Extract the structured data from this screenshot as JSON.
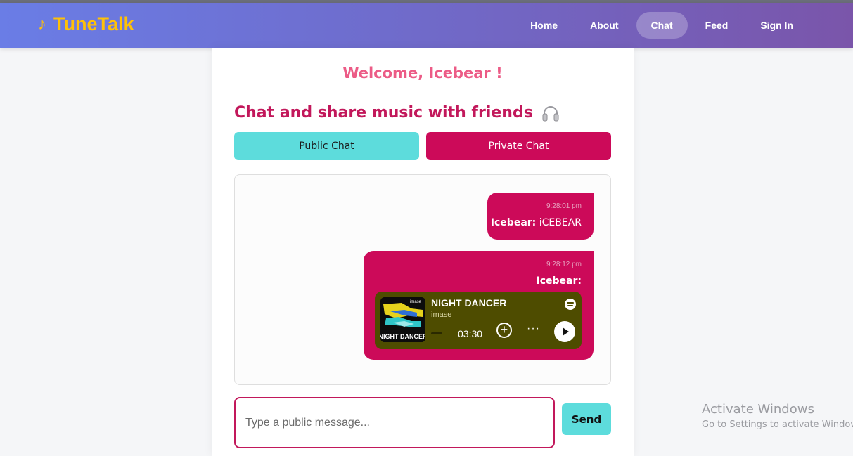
{
  "app": {
    "brand": "TuneTalk",
    "brand_icon": "music-note-icon",
    "colors": {
      "brand": "#ffc107",
      "accent": "#cc0a59",
      "secondary": "#5ddcdc"
    }
  },
  "nav": {
    "items": [
      {
        "label": "Home",
        "active": false
      },
      {
        "label": "About",
        "active": false
      },
      {
        "label": "Chat",
        "active": true
      },
      {
        "label": "Feed",
        "active": false
      },
      {
        "label": "Sign In",
        "active": false
      }
    ]
  },
  "main": {
    "welcome": "Welcome, Icebear !",
    "subtitle": "Chat and share music with friends",
    "subtitle_icon": "headphones-icon",
    "tabs": {
      "public": "Public Chat",
      "private": "Private Chat"
    }
  },
  "messages": [
    {
      "time": "9:28:01 pm",
      "sender": "Icebear:",
      "text": "iCEBEAR"
    },
    {
      "time": "9:28:12 pm",
      "sender": "Icebear:",
      "text": "",
      "embed": {
        "title": "NIGHT DANCER",
        "artist": "imase",
        "duration": "03:30",
        "cover_text": "NIGHT DANCER",
        "cover_tag": "imase",
        "service_icon": "spotify-icon"
      }
    }
  ],
  "composer": {
    "placeholder": "Type a public message...",
    "send_label": "Send"
  },
  "watermark": {
    "line1": "Activate Windows",
    "line2": "Go to Settings to activate Windows."
  }
}
